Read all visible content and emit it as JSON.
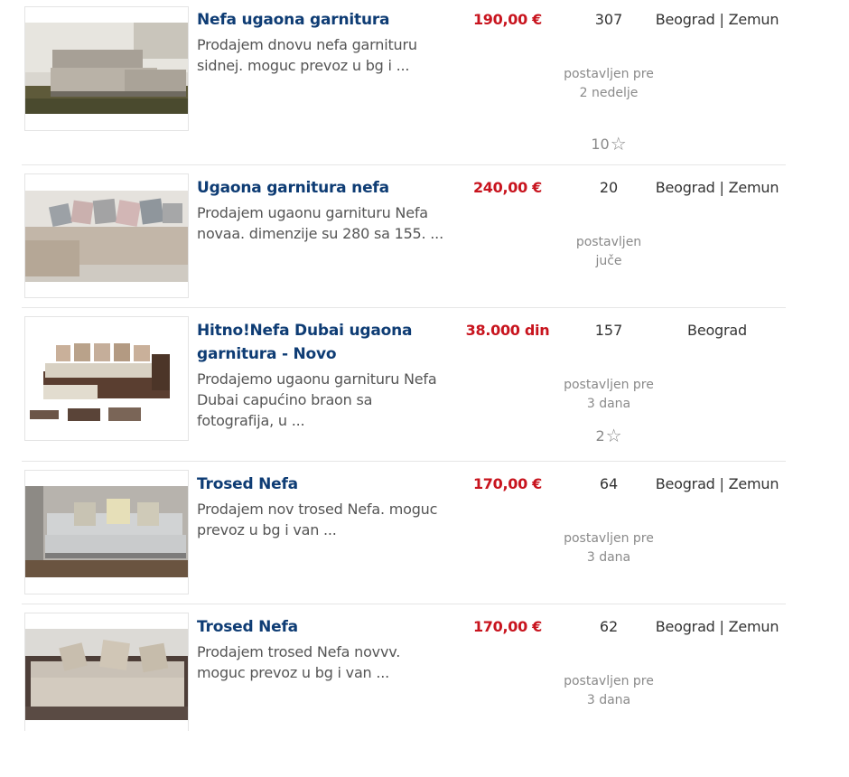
{
  "listings": [
    {
      "title": "Nefa ugaona garnitura",
      "description": "Prodajem dnovu nefa garnituru sidnej. moguc prevoz u bg i ...",
      "price": "190,00 €",
      "views": "307",
      "posted": "postavljen pre 2 nedelje",
      "favorites": "10",
      "location": "Beograd | Zemun",
      "image": "corner-sofa-photo"
    },
    {
      "title": "Ugaona garnitura nefa",
      "description": "Prodajem ugaonu garnituru Nefa novaa. dimenzije su 280 sa 155. ...",
      "price": "240,00 €",
      "views": "20",
      "posted": "postavljen juče",
      "favorites": "",
      "location": "Beograd | Zemun",
      "image": "corner-sofa-cushions-photo"
    },
    {
      "title": "Hitno!Nefa Dubai ugaona garnitura - Novo",
      "description": "Prodajemo ugaonu garnituru Nefa Dubai capućino braon sa fotografija, u ...",
      "price": "38.000 din",
      "views": "157",
      "posted": "postavljen pre 3 dana",
      "favorites": "2",
      "location": "Beograd",
      "image": "dubai-sofa-product-photo"
    },
    {
      "title": "Trosed Nefa",
      "description": "Prodajem nov trosed Nefa. moguc prevoz u bg i van ...",
      "price": "170,00 €",
      "views": "64",
      "posted": "postavljen pre 3 dana",
      "favorites": "",
      "location": "Beograd | Zemun",
      "image": "three-seat-sofa-photo"
    },
    {
      "title": "Trosed Nefa",
      "description": "Prodajem trosed Nefa novvv. moguc prevoz u bg i van ...",
      "price": "170,00 €",
      "views": "62",
      "posted": "postavljen pre 3 dana",
      "favorites": "",
      "location": "Beograd | Zemun",
      "image": "three-seat-sofa-dark-photo"
    }
  ],
  "icons": {
    "favorite": "star-outline-icon"
  },
  "colors": {
    "title": "#0e3c74",
    "price": "#c8141e",
    "muted": "#8a8a8a"
  }
}
